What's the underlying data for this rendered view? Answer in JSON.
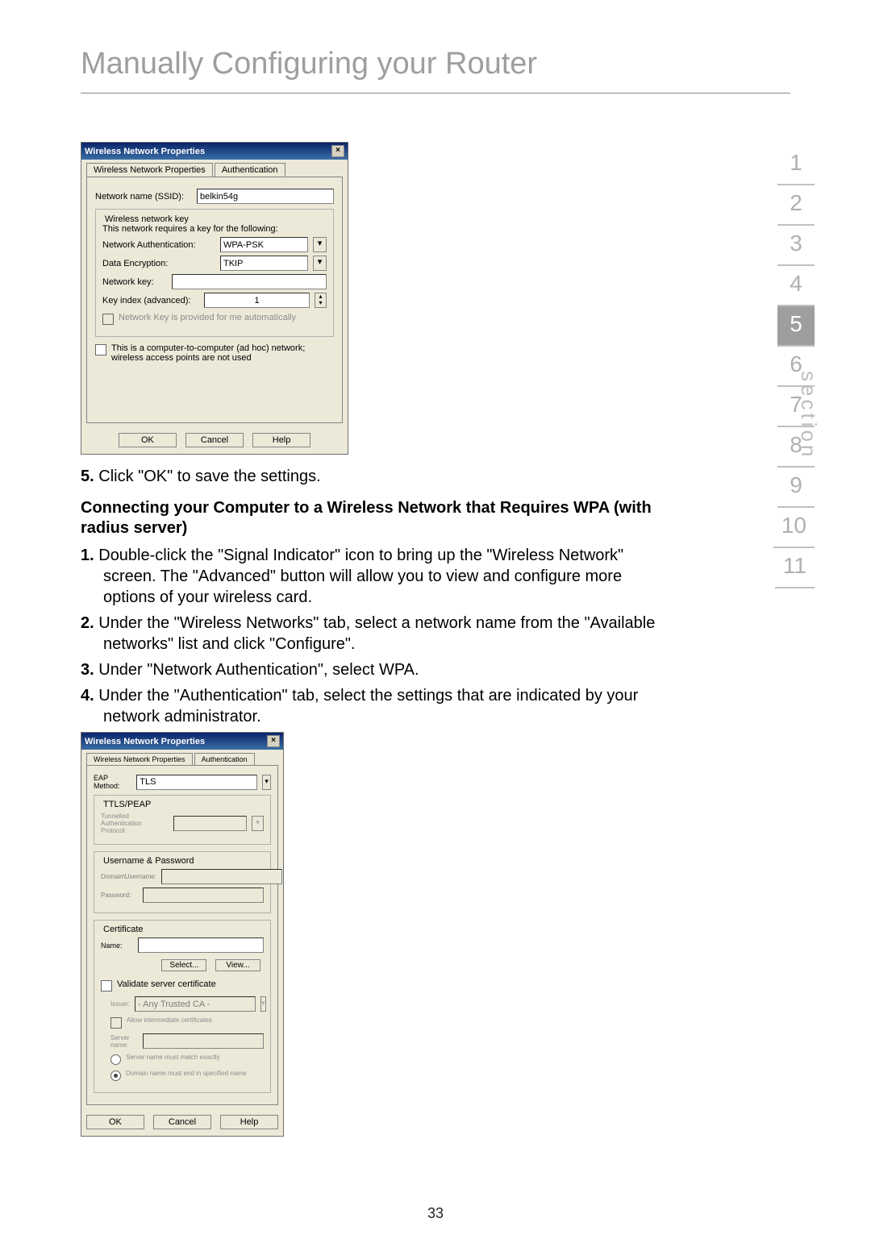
{
  "title": "Manually Configuring your Router",
  "pagenum": "33",
  "sidebar": {
    "label": "section",
    "items": [
      "1",
      "2",
      "3",
      "4",
      "5",
      "6",
      "7",
      "8",
      "9",
      "10",
      "11"
    ],
    "active": 4
  },
  "dlg1": {
    "title": "Wireless Network Properties",
    "tab1": "Wireless Network Properties",
    "tab2": "Authentication",
    "ssid_label": "Network name (SSID):",
    "ssid_value": "belkin54g",
    "key_group": "Wireless network key",
    "key_note": "This network requires a key for the following:",
    "auth_label": "Network Authentication:",
    "auth_value": "WPA-PSK",
    "enc_label": "Data Encryption:",
    "enc_value": "TKIP",
    "netkey_label": "Network key:",
    "netkey_value": "",
    "idx_label": "Key index (advanced):",
    "idx_value": "1",
    "auto_label": "Network Key is provided for me automatically",
    "adhoc_label": "This is a computer-to-computer (ad hoc) network; wireless access points are not used",
    "ok": "OK",
    "cancel": "Cancel",
    "help": "Help"
  },
  "step5": {
    "num": "5.",
    "text": " Click \"OK\" to save the settings."
  },
  "subhead1": "Connecting your Computer to a Wireless Network that Requires WPA (with radius server)",
  "steps": [
    {
      "num": "1.",
      "text": " Double-click the \"Signal Indicator\" icon to bring up the \"Wireless Network\" screen. The \"Advanced\" button will allow you to view and configure more options of your wireless card."
    },
    {
      "num": "2.",
      "text": " Under the \"Wireless Networks\" tab, select a network name from the \"Available networks\" list and click \"Configure\"."
    },
    {
      "num": "3.",
      "text": " Under \"Network Authentication\", select WPA."
    },
    {
      "num": "4.",
      "text": " Under the \"Authentication\" tab, select the settings that are indicated by your network administrator."
    }
  ],
  "dlg2": {
    "title": "Wireless Network Properties",
    "tab1": "Wireless Network Properties",
    "tab2": "Authentication",
    "eap_label": "EAP Method:",
    "eap_value": "TLS",
    "ttls_group": "TTLS/PEAP",
    "tap_label": "Tunnelled Authentication Protocol:",
    "cred_group": "Username & Password",
    "user_label": "Domain\\Username:",
    "pass_label": "Password:",
    "cert_group": "Certificate",
    "name_label": "Name:",
    "select_btn": "Select...",
    "view_btn": "View...",
    "validate_label": "Validate server certificate",
    "issuer_label": "Issuer:",
    "issuer_value": "- Any Trusted CA -",
    "allow_label": "Allow intermediate certificates",
    "server_label": "Server name:",
    "r1_label": "Server name must match exactly",
    "r2_label": "Domain name must end in specified name",
    "ok": "OK",
    "cancel": "Cancel",
    "help": "Help"
  }
}
